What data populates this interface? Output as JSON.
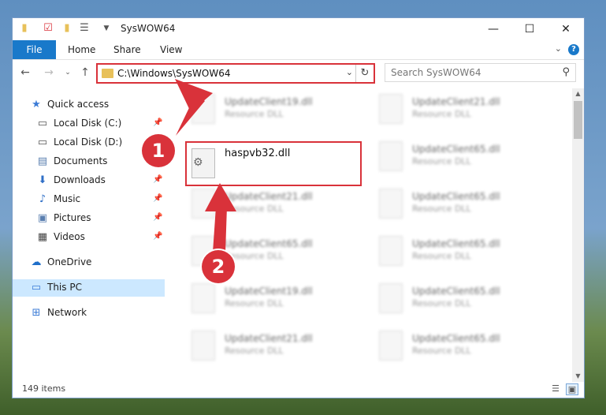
{
  "window": {
    "title": "SysWOW64",
    "minimize": "—",
    "maximize": "☐",
    "close": "✕"
  },
  "ribbon": {
    "file_tab": "File",
    "tabs": [
      "Home",
      "Share",
      "View"
    ],
    "help": "?"
  },
  "address": {
    "path": "C:\\Windows\\SysWOW64",
    "dropdown": "⌄",
    "refresh": "↻"
  },
  "search": {
    "placeholder": "Search SysWOW64"
  },
  "sidebar": {
    "items": [
      {
        "label": "Quick access",
        "icon": "★"
      },
      {
        "label": "Local Disk (C:)",
        "icon": "▭"
      },
      {
        "label": "Local Disk (D:)",
        "icon": "▭"
      },
      {
        "label": "Documents",
        "icon": "▤"
      },
      {
        "label": "Downloads",
        "icon": "⬇"
      },
      {
        "label": "Music",
        "icon": "♪"
      },
      {
        "label": "Pictures",
        "icon": "▣"
      },
      {
        "label": "Videos",
        "icon": "▦"
      },
      {
        "label": "OneDrive",
        "icon": "☁"
      },
      {
        "label": "This PC",
        "icon": "▭"
      },
      {
        "label": "Network",
        "icon": "⊞"
      }
    ]
  },
  "files": {
    "highlighted": {
      "name": "haspvb32.dll"
    },
    "left_column": [
      {
        "name": "UpdateClient19.dll",
        "type": "Resource DLL"
      },
      {
        "name": "UpdateClient21.dll",
        "type": "Resource DLL"
      },
      {
        "name": "UpdateClient65.dll",
        "type": "Resource DLL"
      },
      {
        "name": "UpdateClient19.dll",
        "type": "Resource DLL"
      },
      {
        "name": "UpdateClient21.dll",
        "type": "Resource DLL"
      }
    ],
    "right_column": [
      {
        "name": "UpdateClient21.dll",
        "type": "Resource DLL"
      },
      {
        "name": "UpdateClient65.dll",
        "type": "Resource DLL"
      },
      {
        "name": "UpdateClient65.dll",
        "type": "Resource DLL"
      },
      {
        "name": "UpdateClient65.dll",
        "type": "Resource DLL"
      },
      {
        "name": "UpdateClient65.dll",
        "type": "Resource DLL"
      },
      {
        "name": "UpdateClient65.dll",
        "type": "Resource DLL"
      }
    ]
  },
  "status": {
    "item_count": "149 items"
  },
  "annotations": {
    "step1": "1",
    "step2": "2",
    "color": "#d9323a"
  }
}
